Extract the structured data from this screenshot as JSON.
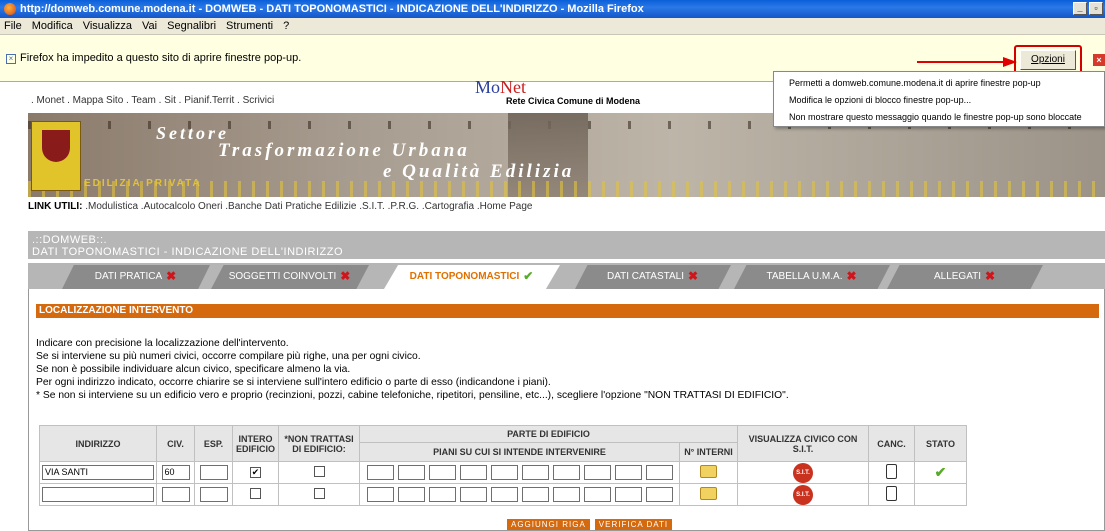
{
  "window": {
    "title": "http://domweb.comune.modena.it - DOMWEB - DATI TOPONOMASTICI - INDICAZIONE DELL'INDIRIZZO - Mozilla Firefox",
    "minimize": "_",
    "maximize": "▫"
  },
  "menubar": [
    "File",
    "Modifica",
    "Visualizza",
    "Vai",
    "Segnalibri",
    "Strumenti",
    "?"
  ],
  "popupbar": {
    "text": "Firefox ha impedito a questo sito di aprire finestre pop-up.",
    "button": "Opzioni",
    "close": "×"
  },
  "popupmenu": [
    "Permetti a domweb.comune.modena.it di aprire finestre pop-up",
    "Modifica le opzioni di blocco finestre pop-up...",
    "Non mostrare questo messaggio quando le finestre pop-up sono bloccate"
  ],
  "site": {
    "topnav": ". Monet . Mappa Sito . Team . Sit . Pianif.Territ . Scrivici",
    "monet_logo_a": "Mo",
    "monet_logo_b": "Net",
    "rete_civica": "Rete Civica Comune di Modena",
    "banner": {
      "line1": "Settore",
      "line2": "Trasformazione Urbana",
      "line3": "e Qualità Edilizia",
      "sub": "EDILIZIA PRIVATA"
    },
    "link_utili_label": "LINK UTILI:",
    "link_utili": " .Modulistica  .Autocalcolo Oneri  .Banche Dati Pratiche Edilizie  .S.I.T.  .P.R.G.  .Cartografia  .Home Page",
    "header_line1": ".::DOMWEB::.",
    "header_line2": "DATI TOPONOMASTICI - INDICAZIONE DELL'INDIRIZZO"
  },
  "tabs": [
    {
      "label": "DATI PRATICA",
      "status": "error",
      "mark": "✖"
    },
    {
      "label": "SOGGETTI COINVOLTI",
      "status": "error",
      "mark": "✖"
    },
    {
      "label": "DATI TOPONOMASTICI",
      "status": "ok",
      "mark": "✔"
    },
    {
      "label": "DATI CATASTALI",
      "status": "error",
      "mark": "✖"
    },
    {
      "label": "TABELLA U.M.A.",
      "status": "error",
      "mark": "✖"
    },
    {
      "label": "ALLEGATI",
      "status": "error",
      "mark": "✖"
    }
  ],
  "section": {
    "title": "LOCALIZZAZIONE INTERVENTO",
    "notes": [
      "Indicare con precisione la localizzazione dell'intervento.",
      "Se si interviene su più numeri civici, occorre compilare più righe, una per ogni civico.",
      "Se non è possibile individuare alcun civico, specificare almeno la via.",
      "Per ogni indirizzo indicato, occorre chiarire se si interviene sull'intero edificio o parte di esso (indicandone i piani).",
      "* Se non si interviene su un edificio vero e proprio (recinzioni, pozzi, cabine telefoniche, ripetitori, pensiline, etc...), scegliere l'opzione \"NON TRATTASI DI EDIFICIO\"."
    ]
  },
  "table": {
    "headers": {
      "indirizzo": "INDIRIZZO",
      "civ": "CIV.",
      "esp": "ESP.",
      "intero": "INTERO EDIFICIO",
      "non_trattasi": "*NON TRATTASI DI EDIFICIO:",
      "parte": "PARTE DI EDIFICIO",
      "piani": "PIANI SU CUI SI INTENDE INTERVENIRE",
      "interni": "N° INTERNI",
      "visualizza": "VISUALIZZA CIVICO CON S.I.T.",
      "canc": "CANC.",
      "stato": "STATO"
    },
    "rows": [
      {
        "indirizzo": "VIA SANTI",
        "civ": "60",
        "esp": "",
        "intero": true,
        "non_trattasi": false,
        "stato": "ok"
      },
      {
        "indirizzo": "",
        "civ": "",
        "esp": "",
        "intero": false,
        "non_trattasi": false,
        "stato": ""
      }
    ],
    "sit_label": "S.I.T."
  },
  "buttons": {
    "add": "AGGIUNGI RIGA",
    "verify": "VERIFICA DATI"
  }
}
